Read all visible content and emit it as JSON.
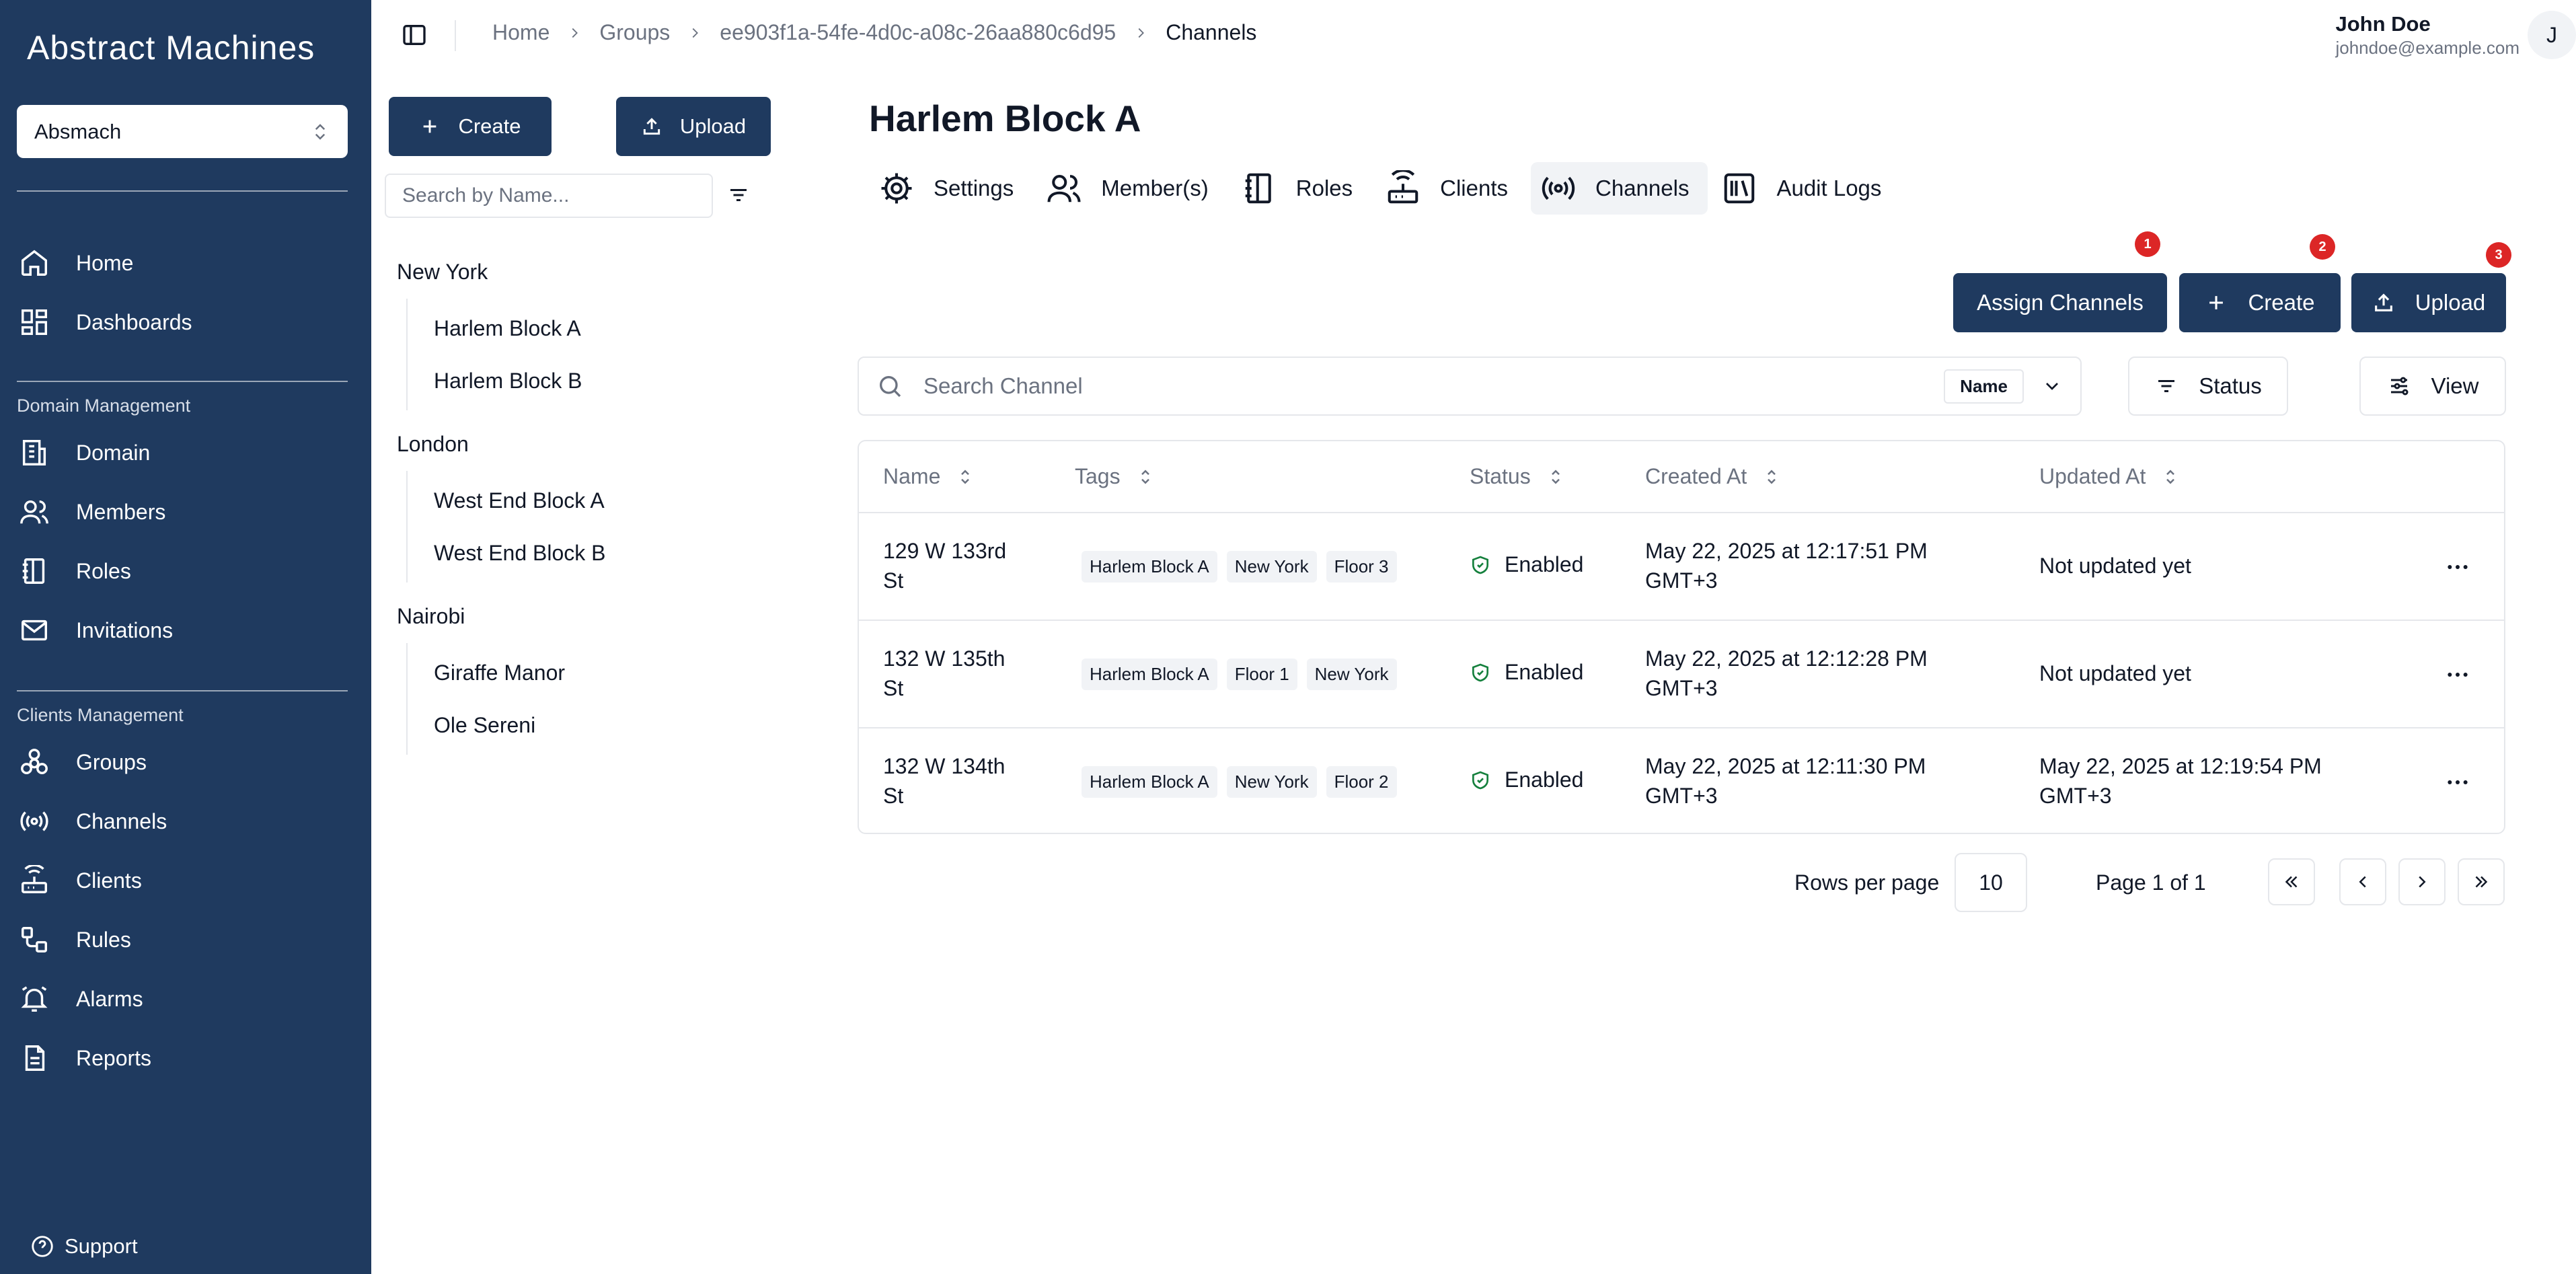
{
  "sidebar": {
    "logo": "Abstract Machines",
    "workspace": "Absmach",
    "main_items": [
      {
        "label": "Home",
        "icon": "home-icon"
      },
      {
        "label": "Dashboards",
        "icon": "dashboard-icon"
      }
    ],
    "domain_heading": "Domain Management",
    "domain_items": [
      {
        "label": "Domain",
        "icon": "building-icon"
      },
      {
        "label": "Members",
        "icon": "users-icon"
      },
      {
        "label": "Roles",
        "icon": "notebook-icon"
      },
      {
        "label": "Invitations",
        "icon": "mail-icon"
      }
    ],
    "clients_heading": "Clients Management",
    "clients_items": [
      {
        "label": "Groups",
        "icon": "groups-icon"
      },
      {
        "label": "Channels",
        "icon": "radio-icon"
      },
      {
        "label": "Clients",
        "icon": "router-icon"
      },
      {
        "label": "Rules",
        "icon": "workflow-icon"
      },
      {
        "label": "Alarms",
        "icon": "bell-icon"
      },
      {
        "label": "Reports",
        "icon": "file-icon"
      }
    ],
    "support": "Support"
  },
  "breadcrumb": {
    "items": [
      "Home",
      "Groups",
      "ee903f1a-54fe-4d0c-a08c-26aa880c6d95"
    ],
    "current": "Channels"
  },
  "user": {
    "name": "John Doe",
    "email": "johndoe@example.com",
    "initial": "J"
  },
  "tree": {
    "create_label": "Create",
    "upload_label": "Upload",
    "search_placeholder": "Search by Name...",
    "groups": [
      {
        "name": "New York",
        "children": [
          "Harlem Block A",
          "Harlem Block B"
        ]
      },
      {
        "name": "London",
        "children": [
          "West End Block A",
          "West End Block B"
        ]
      },
      {
        "name": "Nairobi",
        "children": [
          "Giraffe Manor",
          "Ole Sereni"
        ]
      }
    ]
  },
  "main": {
    "title": "Harlem Block A",
    "tabs": [
      "Settings",
      "Member(s)",
      "Roles",
      "Clients",
      "Channels",
      "Audit Logs"
    ],
    "active_tab": "Channels",
    "actions": {
      "assign": "Assign Channels",
      "create": "Create",
      "upload": "Upload",
      "badges": [
        "1",
        "2",
        "3"
      ]
    },
    "search_placeholder": "Search Channel",
    "search_field": "Name",
    "status_filter": "Status",
    "view_label": "View",
    "columns": [
      "Name",
      "Tags",
      "Status",
      "Created At",
      "Updated At"
    ],
    "rows": [
      {
        "name_l1": "129 W 133rd",
        "name_l2": "St",
        "tags": [
          "Harlem Block A",
          "New York",
          "Floor 3"
        ],
        "status": "Enabled",
        "created_l1": "May 22, 2025 at 12:17:51 PM",
        "created_l2": "GMT+3",
        "updated_l1": "Not updated yet",
        "updated_l2": ""
      },
      {
        "name_l1": "132 W 135th",
        "name_l2": "St",
        "tags": [
          "Harlem Block A",
          "Floor 1",
          "New York"
        ],
        "status": "Enabled",
        "created_l1": "May 22, 2025 at 12:12:28 PM",
        "created_l2": "GMT+3",
        "updated_l1": "Not updated yet",
        "updated_l2": ""
      },
      {
        "name_l1": "132 W 134th",
        "name_l2": "St",
        "tags": [
          "Harlem Block A",
          "New York",
          "Floor 2"
        ],
        "status": "Enabled",
        "created_l1": "May 22, 2025 at 12:11:30 PM",
        "created_l2": "GMT+3",
        "updated_l1": "May 22, 2025 at 12:19:54 PM",
        "updated_l2": "GMT+3"
      }
    ],
    "pagination": {
      "rows_per_page_label": "Rows per page",
      "rows_per_page": "10",
      "page_info": "Page 1 of 1"
    }
  },
  "colors": {
    "sidebar_bg": "#1f3a5f",
    "primary": "#1f3a5f",
    "badge": "#dc2626",
    "border": "#e5e7eb"
  }
}
